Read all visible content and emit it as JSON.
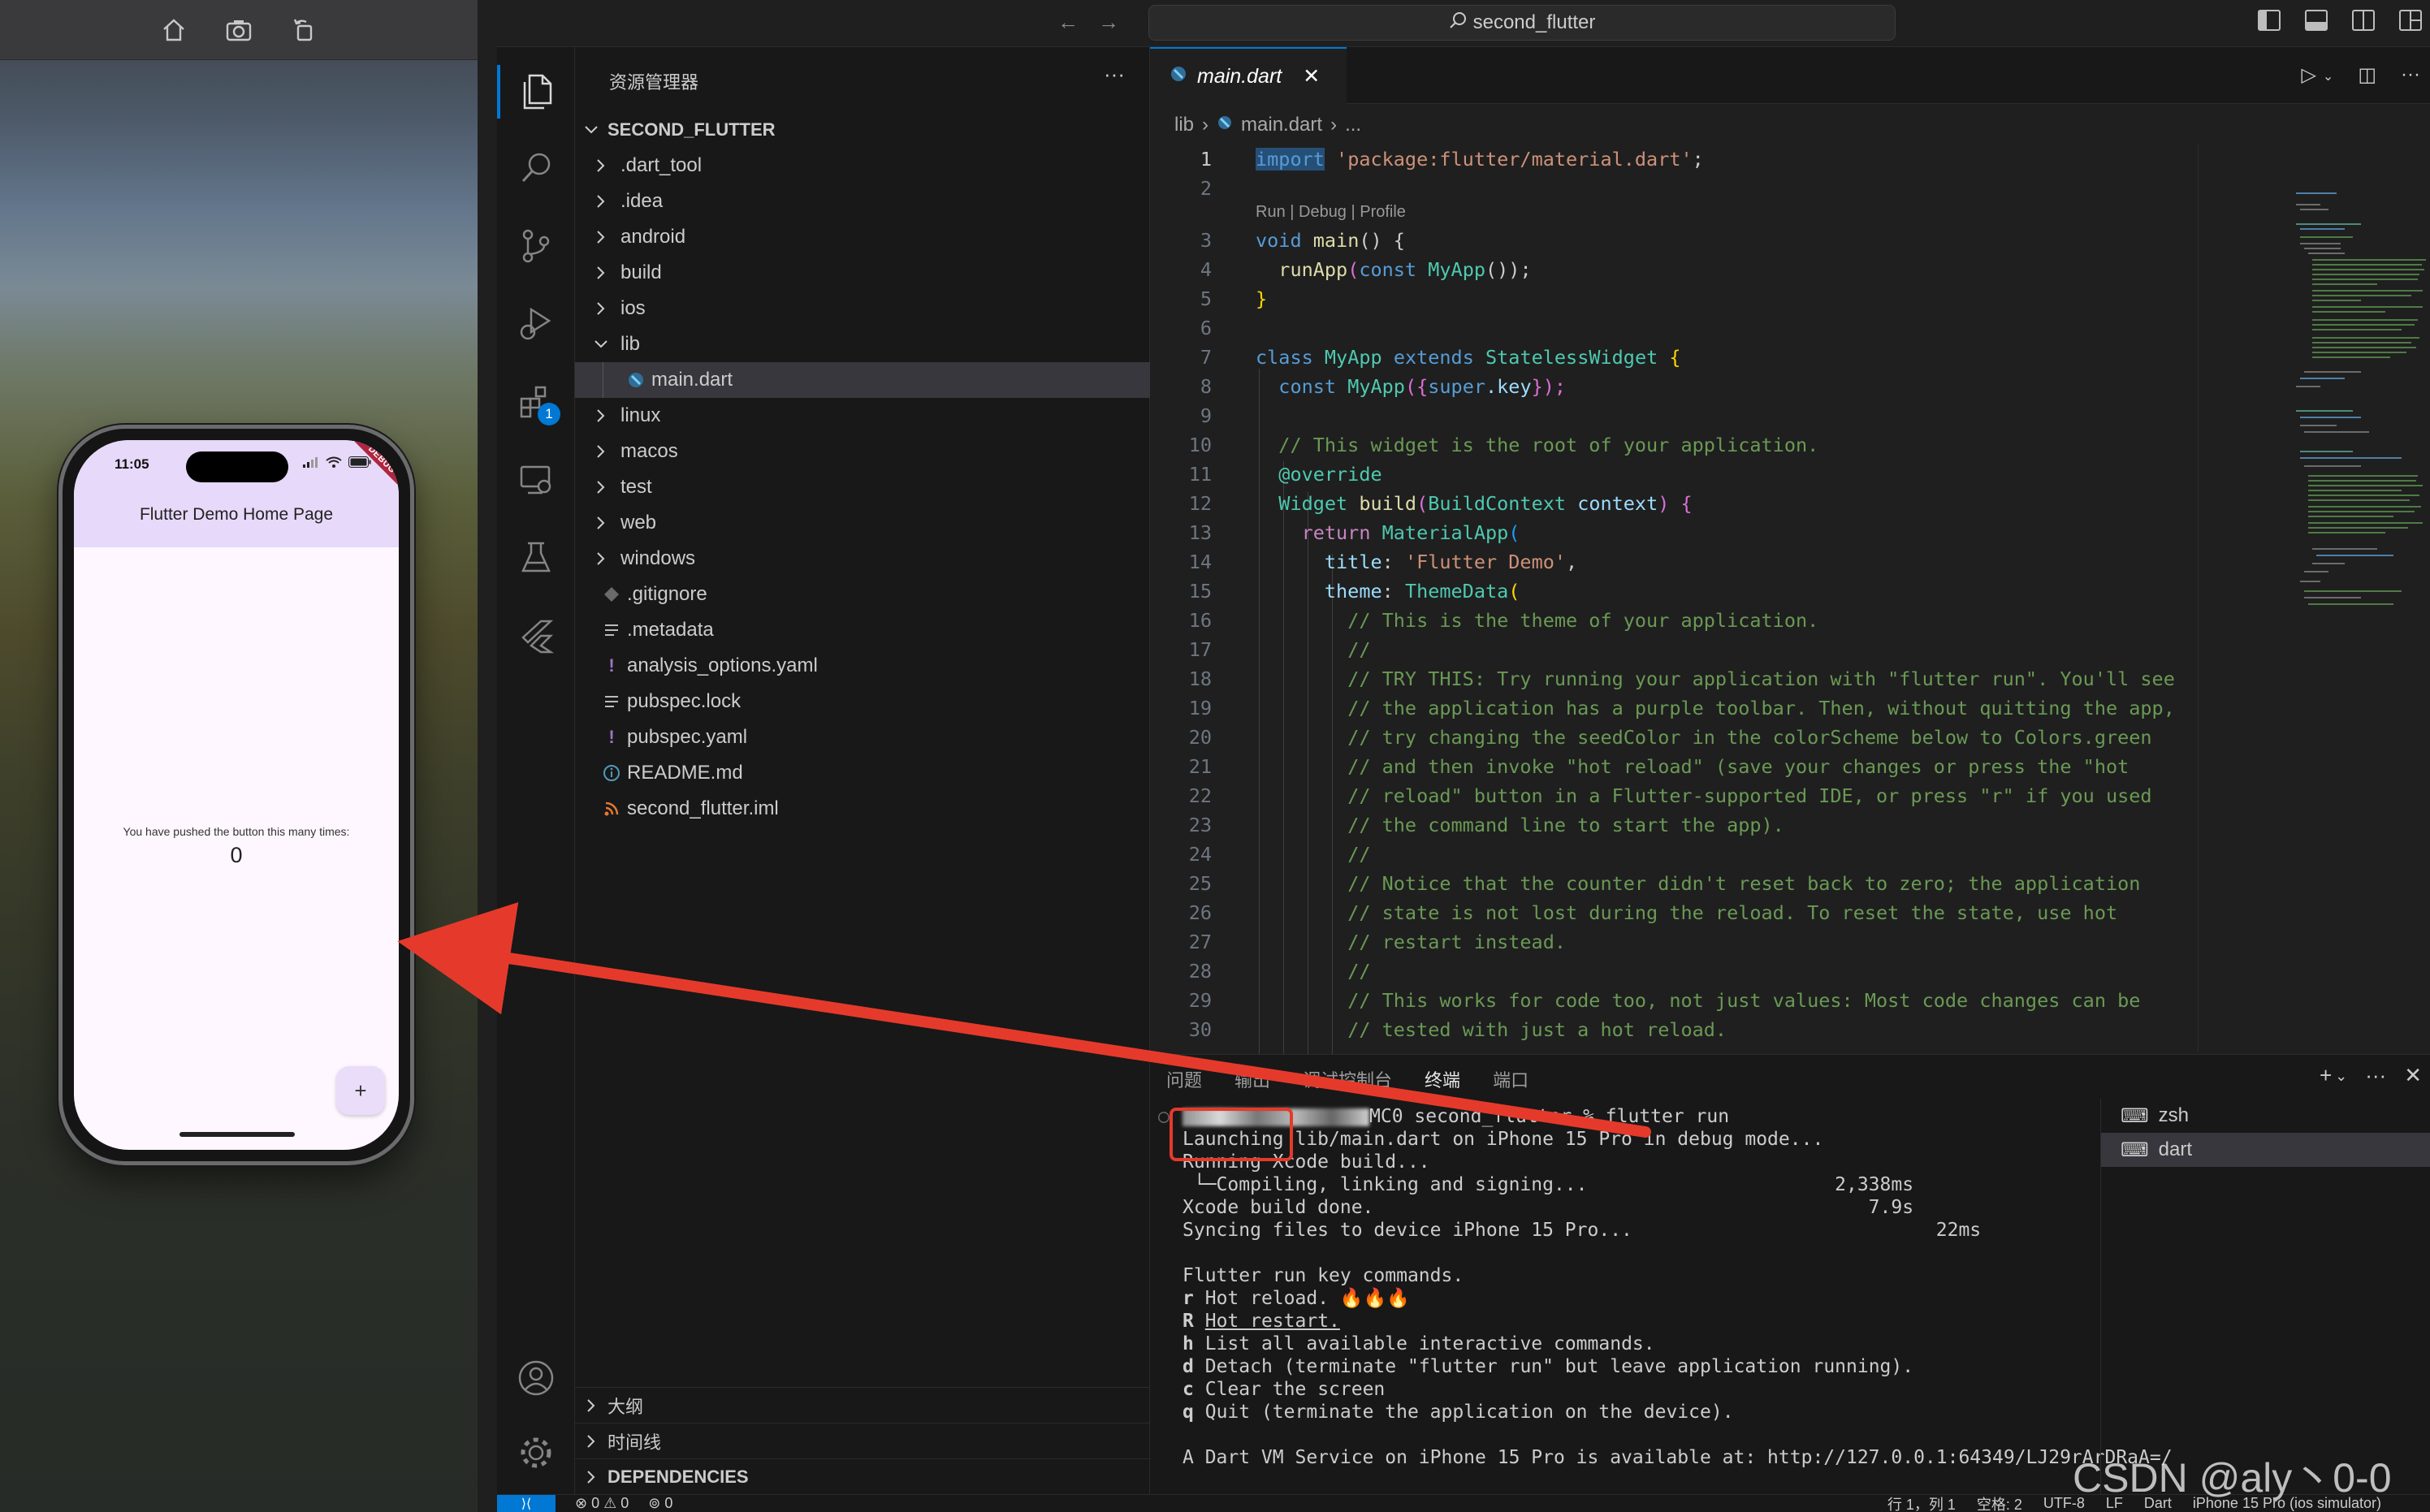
{
  "colors": {
    "accent": "#0078d4",
    "annotation_red": "#e53a2b",
    "app_bar": "#e7d9f9",
    "phone_bg": "#fef7ff"
  },
  "simulator": {
    "toolbar_icons": [
      "home-icon",
      "screenshot-icon",
      "rotate-icon"
    ],
    "status_time": "11:05",
    "debug_banner": "DEBUG",
    "app_title": "Flutter Demo Home Page",
    "counter_label": "You have pushed the button this many times:",
    "counter_value": "0",
    "fab_label": "+"
  },
  "window": {
    "search_text": "second_flutter"
  },
  "sidebar": {
    "title": "资源管理器",
    "root": "SECOND_FLUTTER",
    "items": [
      {
        "label": ".dart_tool",
        "kind": "folder"
      },
      {
        "label": ".idea",
        "kind": "folder"
      },
      {
        "label": "android",
        "kind": "folder"
      },
      {
        "label": "build",
        "kind": "folder"
      },
      {
        "label": "ios",
        "kind": "folder"
      },
      {
        "label": "lib",
        "kind": "folder-open"
      },
      {
        "label": "main.dart",
        "kind": "dart"
      },
      {
        "label": "linux",
        "kind": "folder"
      },
      {
        "label": "macos",
        "kind": "folder"
      },
      {
        "label": "test",
        "kind": "folder"
      },
      {
        "label": "web",
        "kind": "folder"
      },
      {
        "label": "windows",
        "kind": "folder"
      },
      {
        "label": ".gitignore",
        "kind": "git"
      },
      {
        "label": ".metadata",
        "kind": "lines"
      },
      {
        "label": "analysis_options.yaml",
        "kind": "yaml"
      },
      {
        "label": "pubspec.lock",
        "kind": "lines"
      },
      {
        "label": "pubspec.yaml",
        "kind": "yaml"
      },
      {
        "label": "README.md",
        "kind": "info"
      },
      {
        "label": "second_flutter.iml",
        "kind": "rss"
      }
    ],
    "bottom_sections": [
      "大纲",
      "时间线",
      "DEPENDENCIES"
    ]
  },
  "activity_bar": {
    "extensions_badge": "1"
  },
  "editor": {
    "tab_label": "main.dart",
    "breadcrumb": [
      "lib",
      "main.dart",
      "..."
    ],
    "code_lens": "Run | Debug | Profile",
    "line_numbers": [
      "1",
      "2",
      "3",
      "4",
      "5",
      "6",
      "7",
      "8",
      "9",
      "10",
      "11",
      "12",
      "13",
      "14",
      "15",
      "16",
      "17",
      "18",
      "19",
      "20",
      "21",
      "22",
      "23",
      "24",
      "25",
      "26",
      "27",
      "28",
      "29",
      "30"
    ],
    "lines": {
      "l1_kw": "import",
      "l1_str": "'package:flutter/material.dart'",
      "l1_end": ";",
      "l3_kw": "void",
      "l3_fn": "main",
      "l3_end": "() {",
      "l4_fn": "runApp",
      "l4_kw": "const",
      "l4_cls": "MyApp",
      "l4_end": "());",
      "l5": "}",
      "l7_kw": "class",
      "l7_cls": "MyApp",
      "l7_kw2": "extends",
      "l7_cls2": "StatelessWidget",
      "l7_end": "{",
      "l8_kw": "const",
      "l8_cls": "MyApp",
      "l8_mid": "({",
      "l8_var": "super",
      "l8_key": ".key",
      "l8_end": "});",
      "l10": "// This widget is the root of your application.",
      "l11": "@override",
      "l12_cls": "Widget",
      "l12_fn": "build",
      "l12_cls2": "BuildContext",
      "l12_var": "context",
      "l12_end": ") {",
      "l13_kw": "return",
      "l13_cls": "MaterialApp",
      "l14_var": "title",
      "l14_str": "'Flutter Demo'",
      "l14_end": ",",
      "l15_var": "theme",
      "l15_cls": "ThemeData",
      "l16": "// This is the theme of your application.",
      "l17": "//",
      "l18": "// TRY THIS: Try running your application with \"flutter run\". You'll see",
      "l19": "// the application has a purple toolbar. Then, without quitting the app,",
      "l20": "// try changing the seedColor in the colorScheme below to Colors.green",
      "l21": "// and then invoke \"hot reload\" (save your changes or press the \"hot",
      "l22": "// reload\" button in a Flutter-supported IDE, or press \"r\" if you used",
      "l23": "// the command line to start the app).",
      "l24": "//",
      "l25": "// Notice that the counter didn't reset back to zero; the application",
      "l26": "// state is not lost during the reload. To reset the state, use hot",
      "l27": "// restart instead.",
      "l28": "//",
      "l29": "// This works for code too, not just values: Most code changes can be",
      "l30": "// tested with just a hot reload."
    }
  },
  "panel": {
    "tabs": [
      "问题",
      "输出",
      "调试控制台",
      "终端",
      "端口"
    ],
    "active_tab": "终端",
    "terminals": [
      "zsh",
      "dart"
    ],
    "prompt_visible": "MC0 second_flutter % ",
    "prompt_command": "flutter run",
    "output": [
      "Launching lib/main.dart on iPhone 15 Pro in debug mode...",
      "Running Xcode build...",
      " └─Compiling, linking and signing...                      2,338ms",
      "Xcode build done.                                            7.9s",
      "Syncing files to device iPhone 15 Pro...                           22ms",
      "",
      "Flutter run key commands."
    ],
    "keys": [
      {
        "key": "r",
        "text": "Hot reload. 🔥🔥🔥"
      },
      {
        "key": "R",
        "text": "Hot restart."
      },
      {
        "key": "h",
        "text": "List all available interactive commands."
      },
      {
        "key": "d",
        "text": "Detach (terminate \"flutter run\" but leave application running)."
      },
      {
        "key": "c",
        "text": "Clear the screen"
      },
      {
        "key": "q",
        "text": "Quit (terminate the application on the device)."
      }
    ],
    "service_line": "A Dart VM Service on iPhone 15 Pro is available at: http://127.0.0.1:64349/LJ29rArDRaA=/"
  },
  "statusbar": {
    "errors": "0",
    "warnings": "0",
    "ports": "0",
    "line_col": "行 1，列 1",
    "spaces": "空格: 2",
    "encoding": "UTF-8",
    "eol": "LF",
    "language": "Dart",
    "device": "iPhone 15 Pro (ios simulator)"
  },
  "watermark": "CSDN @aly丶0-0"
}
